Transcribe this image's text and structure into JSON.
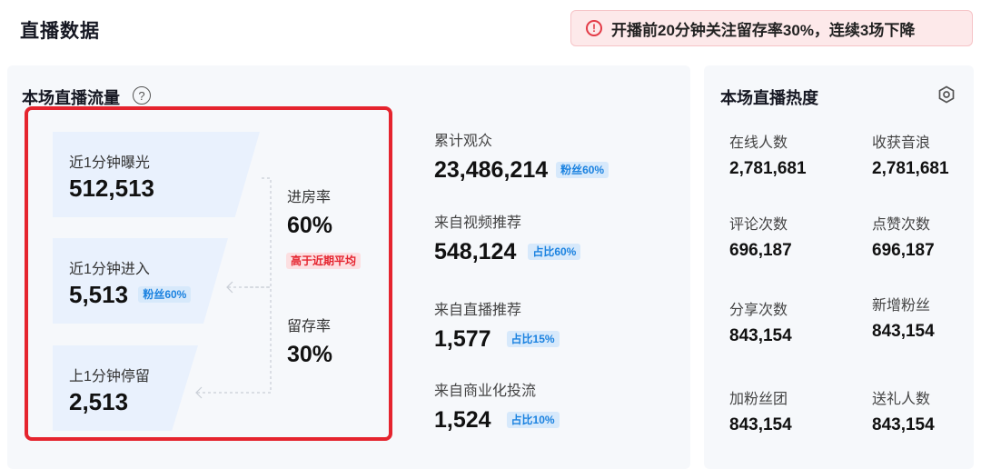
{
  "page": {
    "title": "直播数据"
  },
  "alert": {
    "icon": "alert-circle-icon",
    "text": "开播前20分钟关注留存率30%，连续3场下降",
    "color": "#e33a46"
  },
  "traffic": {
    "title": "本场直播流量",
    "help_icon": "question-circle-icon",
    "funnel": [
      {
        "label": "近1分钟曝光",
        "value": "512,513",
        "tag": ""
      },
      {
        "label": "近1分钟进入",
        "value": "5,513",
        "tag": "粉丝60%"
      },
      {
        "label": "上1分钟停留",
        "value": "2,513",
        "tag": ""
      }
    ],
    "entry_rate": {
      "label": "进房率",
      "value": "60%",
      "badge": "高于近期平均"
    },
    "retention_rate": {
      "label": "留存率",
      "value": "30%"
    },
    "sources": [
      {
        "label": "累计观众",
        "value": "23,486,214",
        "tag": "粉丝60%"
      },
      {
        "label": "来自视频推荐",
        "value": "548,124",
        "tag": "占比60%"
      },
      {
        "label": "来自直播推荐",
        "value": "1,577",
        "tag": "占比15%"
      },
      {
        "label": "来自商业化投流",
        "value": "1,524",
        "tag": "占比10%"
      }
    ]
  },
  "heat": {
    "title": "本场直播热度",
    "settings_icon": "settings-hex-icon",
    "metrics": [
      {
        "label": "在线人数",
        "value": "2,781,681"
      },
      {
        "label": "收获音浪",
        "value": "2,781,681"
      },
      {
        "label": "评论次数",
        "value": "696,187"
      },
      {
        "label": "点赞次数",
        "value": "696,187"
      },
      {
        "label": "分享次数",
        "value": "843,154"
      },
      {
        "label": "新增粉丝",
        "value": "843,154"
      },
      {
        "label": "加粉丝团",
        "value": "843,154"
      },
      {
        "label": "送礼人数",
        "value": "843,154"
      }
    ]
  },
  "colors": {
    "accent_blue": "#1b82e0",
    "highlight_red": "#e5242e",
    "card_bg": "#e9f1fd"
  }
}
